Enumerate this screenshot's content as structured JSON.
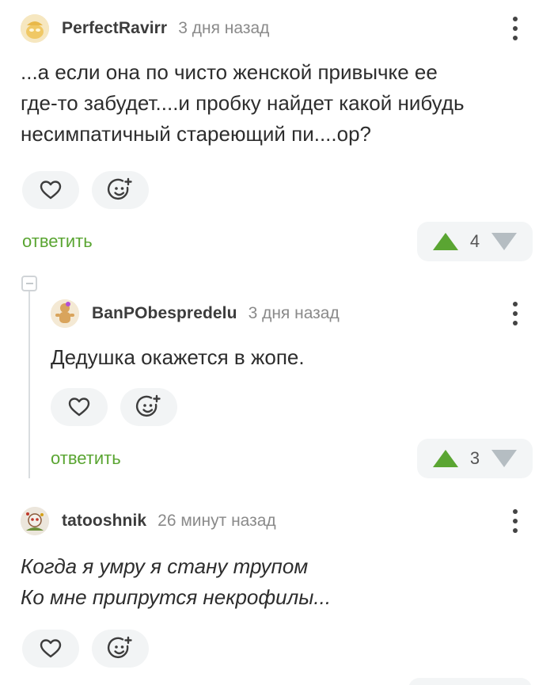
{
  "comments": [
    {
      "username": "PerfectRavirr",
      "time": "3 дня назад",
      "lines": [
        "...а если она по чисто женской привычке ее",
        "где-то забудет....и пробку найдет какой нибудь",
        "несимпатичный стареющий пи....ор?"
      ],
      "reply_label": "ответить",
      "score": "4"
    },
    {
      "username": "BanPObespredelu",
      "time": "3 дня назад",
      "lines": [
        "Дедушка окажется в жопе."
      ],
      "reply_label": "ответить",
      "score": "3"
    },
    {
      "username": "tatooshnik",
      "time": "26 минут назад",
      "lines": [
        "Когда я умру я стану трупом",
        "Ко мне припрутся некрофилы..."
      ]
    }
  ],
  "icons": {
    "like": "heart-icon",
    "reaction": "add-emoji-icon",
    "upvote": "upvote-arrow-icon",
    "downvote": "downvote-arrow-icon",
    "menu": "more-vertical-icon",
    "collapse": "collapse-thread-icon"
  },
  "colors": {
    "accent_green": "#5aa532",
    "downvote_gray": "#b5bdc2",
    "pill_bg": "#f2f4f5",
    "thread_line": "#d9dde0"
  }
}
